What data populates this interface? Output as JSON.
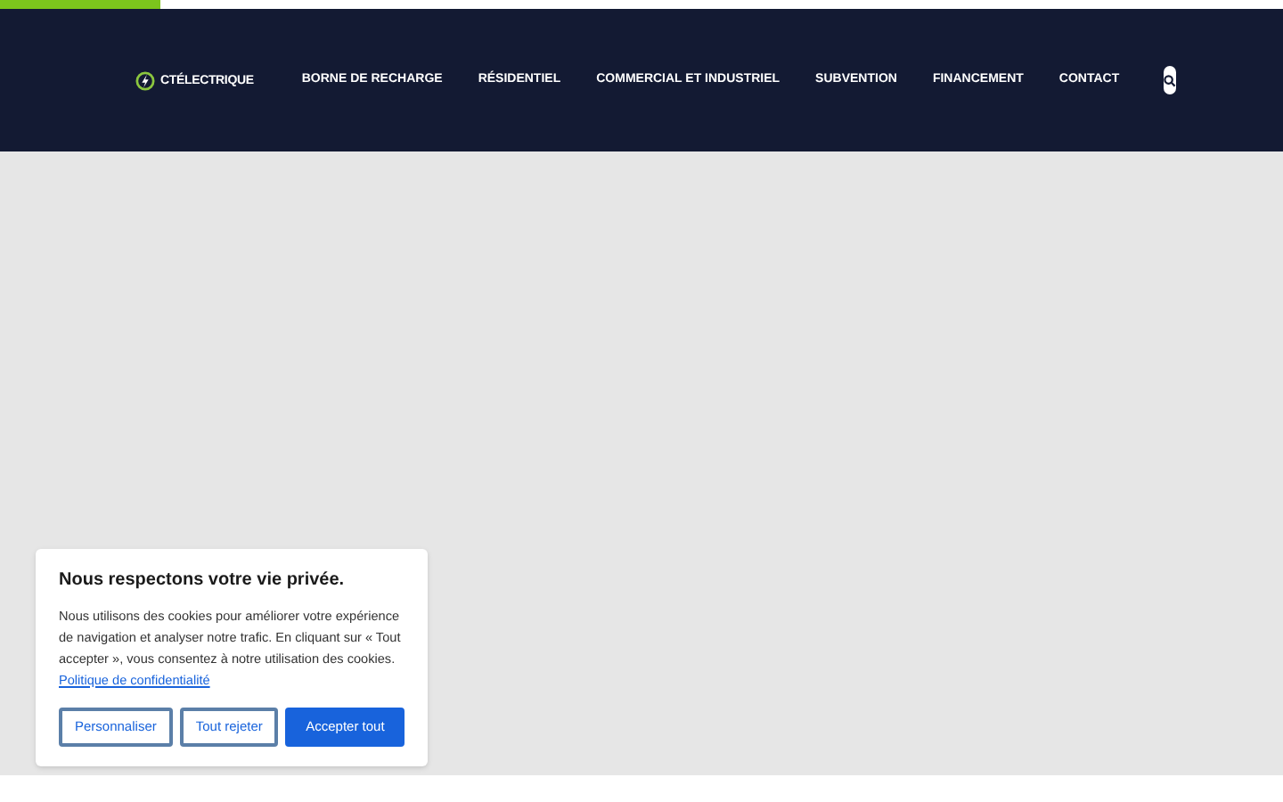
{
  "progress": {
    "level": 0.125
  },
  "header": {
    "logo": "CTÉLECTRIQUE",
    "nav": [
      {
        "label": "BORNE DE RECHARGE"
      },
      {
        "label": "RÉSIDENTIEL"
      },
      {
        "label": "COMMERCIAL ET INDUSTRIEL"
      },
      {
        "label": "SUBVENTION"
      },
      {
        "label": "FINANCEMENT"
      },
      {
        "label": "CONTACT"
      }
    ]
  },
  "cookie_banner": {
    "title": "Nous respectons votre vie privée.",
    "text": "Nous utilisons des cookies pour améliorer votre expérience de navigation et analyser notre trafic. En cliquant sur « Tout accepter », vous consentez à notre utilisation des cookies.",
    "link": "Politique de confidentialité",
    "buttons": [
      {
        "label": "Personnaliser",
        "kind": "outline"
      },
      {
        "label": "Tout rejeter",
        "kind": "outline"
      },
      {
        "label": "Accepter tout",
        "kind": "primary"
      }
    ]
  }
}
